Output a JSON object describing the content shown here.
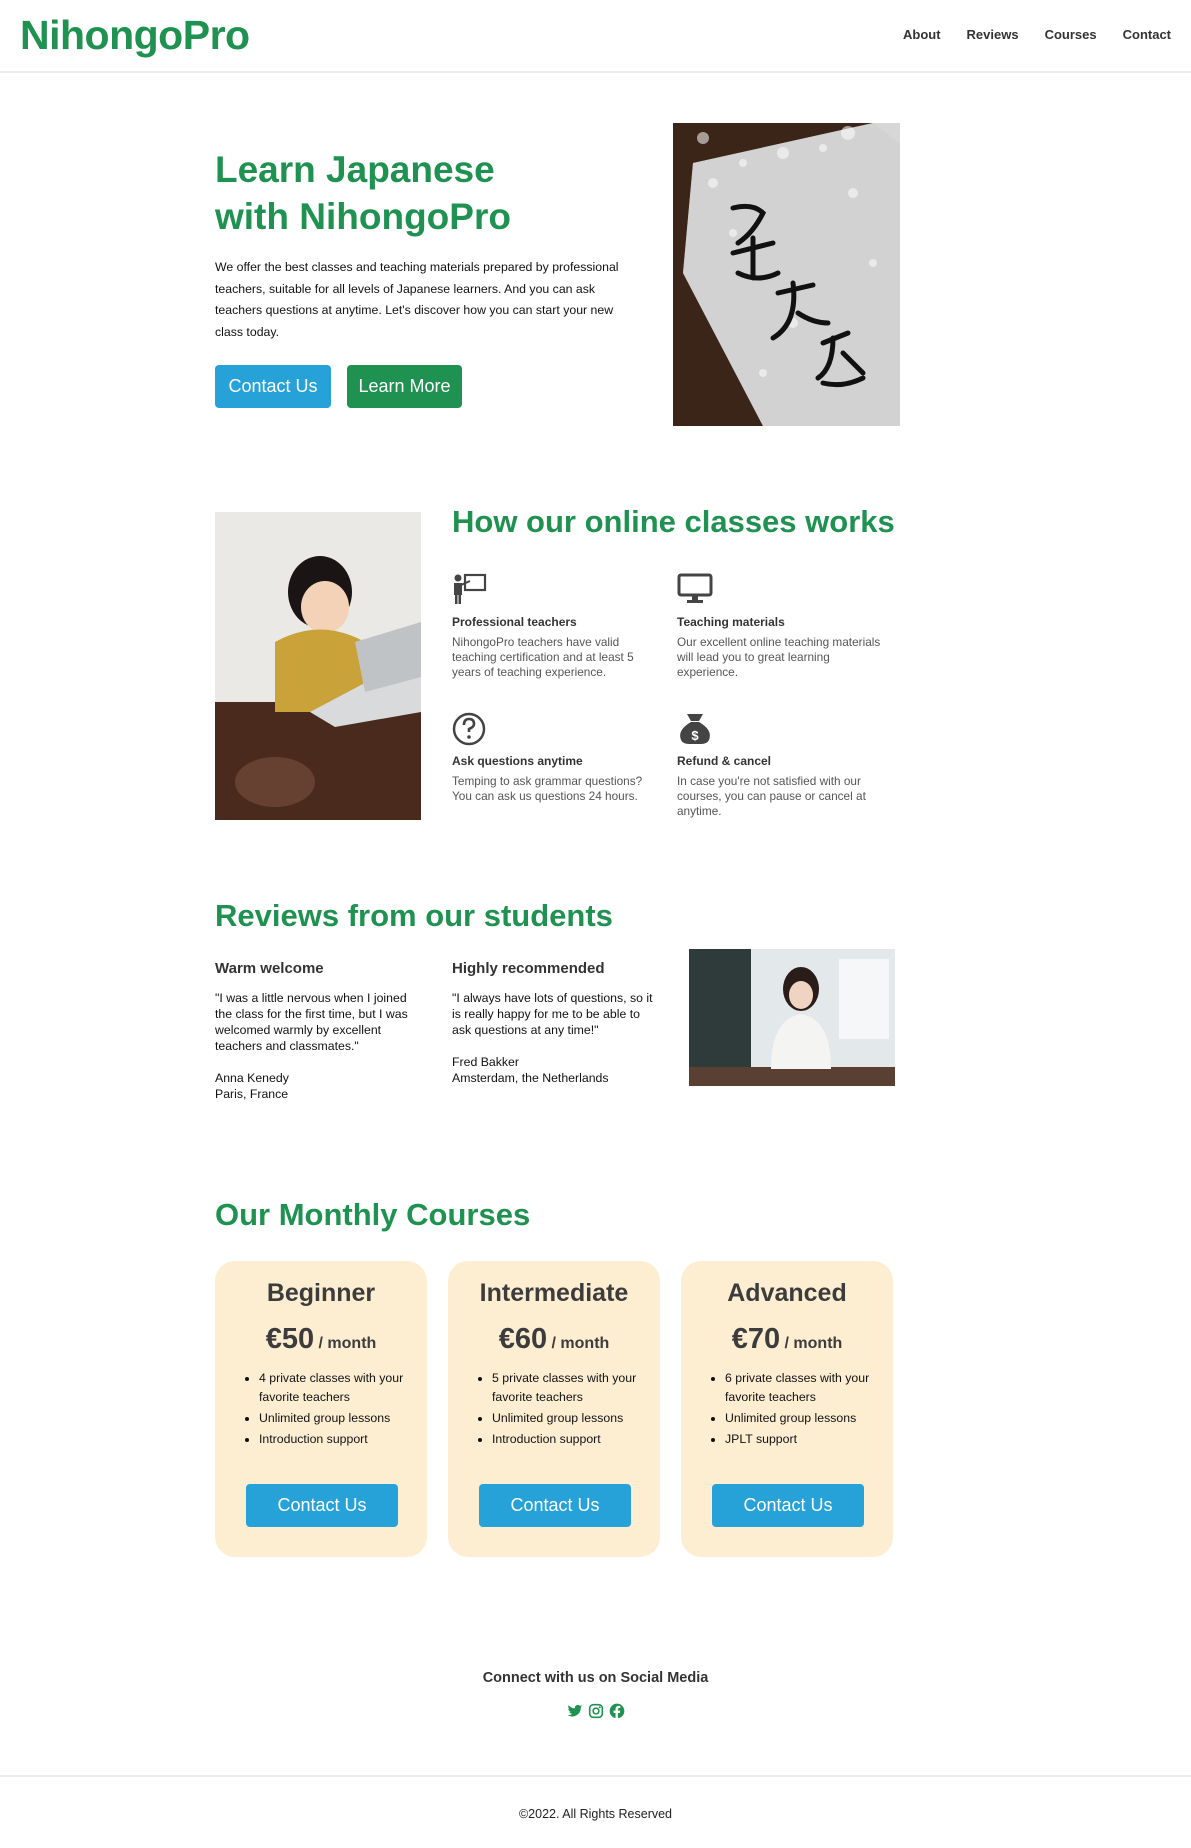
{
  "header": {
    "logo": "NihongoPro",
    "nav": [
      "About",
      "Reviews",
      "Courses",
      "Contact"
    ]
  },
  "hero": {
    "title_line1": "Learn Japanese",
    "title_line2": "with NihongoPro",
    "text": "We offer the best classes and teaching materials prepared by professional teachers, suitable for all levels of Japanese learners. And you can ask teachers questions at anytime. Let's discover how you can start your new class today.",
    "btn_contact": "Contact Us",
    "btn_learn": "Learn More"
  },
  "how": {
    "title": "How our online classes works",
    "features": [
      {
        "icon": "teacher-icon",
        "title": "Professional teachers",
        "text": "NihongoPro teachers have valid teaching certification and at least 5 years of teaching experience."
      },
      {
        "icon": "monitor-icon",
        "title": "Teaching materials",
        "text": "Our excellent online teaching materials will lead you to great learning experience."
      },
      {
        "icon": "question-icon",
        "title": "Ask questions anytime",
        "text": "Temping to ask grammar questions? You can ask us questions 24 hours."
      },
      {
        "icon": "money-bag-icon",
        "title": "Refund & cancel",
        "text": "In case you're not satisfied with our courses, you can pause or cancel at anytime."
      }
    ]
  },
  "reviews": {
    "title": "Reviews from our students",
    "items": [
      {
        "heading": "Warm welcome",
        "quote": "\"I was a little nervous when I joined the class for the first time, but I was welcomed warmly by excellent teachers and classmates.\"",
        "name": "Anna Kenedy",
        "place": "Paris, France"
      },
      {
        "heading": "Highly recommended",
        "quote": "\"I always have lots of questions, so it is really happy for me to be able to ask questions at any time!\"",
        "name": "Fred Bakker",
        "place": "Amsterdam, the Netherlands"
      }
    ]
  },
  "courses": {
    "title": "Our Monthly Courses",
    "cards": [
      {
        "name": "Beginner",
        "price": "€50",
        "per": "/ month",
        "features": [
          "4 private classes with your favorite teachers",
          "Unlimited group lessons",
          "Introduction support"
        ],
        "btn": "Contact Us"
      },
      {
        "name": "Intermediate",
        "price": "€60",
        "per": "/ month",
        "features": [
          "5 private classes with your favorite teachers",
          "Unlimited group lessons",
          "Introduction support"
        ],
        "btn": "Contact Us"
      },
      {
        "name": "Advanced",
        "price": "€70",
        "per": "/ month",
        "features": [
          "6 private classes with your favorite teachers",
          "Unlimited group lessons",
          "JPLT support"
        ],
        "btn": "Contact Us"
      }
    ]
  },
  "social": {
    "title": "Connect with us on Social Media",
    "icons": [
      "twitter-icon",
      "instagram-icon",
      "facebook-icon"
    ]
  },
  "footer": {
    "copyright": "©2022. All Rights Reserved"
  },
  "colors": {
    "brand_green": "#1f9150",
    "button_blue": "#26a2d8",
    "card_bg": "#fdeed2"
  }
}
